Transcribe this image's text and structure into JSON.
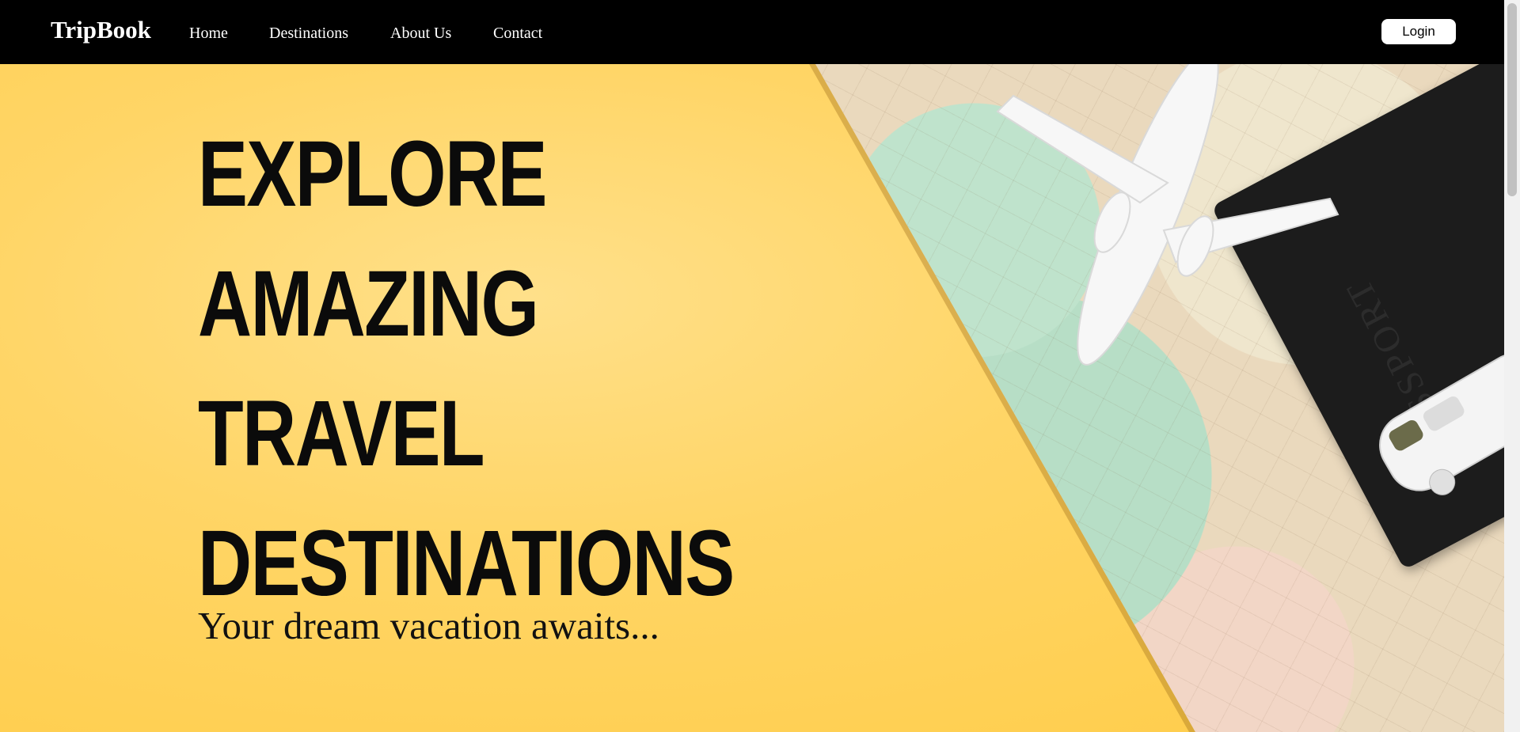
{
  "navbar": {
    "brand": "TripBook",
    "links": [
      "Home",
      "Destinations",
      "About Us",
      "Contact"
    ],
    "login_label": "Login"
  },
  "hero": {
    "headline_lines": [
      "EXPLORE",
      "AMAZING",
      "TRAVEL",
      "DESTINATIONS"
    ],
    "tagline": "Your dream vacation awaits...",
    "passport_text": "PASSPORT"
  },
  "colors": {
    "navbar_bg": "#000000",
    "hero_bg": "#ffd25a",
    "headline": "#0b0b0b"
  },
  "icons": [
    "airplane-toy",
    "passport",
    "toy-van",
    "world-map"
  ]
}
